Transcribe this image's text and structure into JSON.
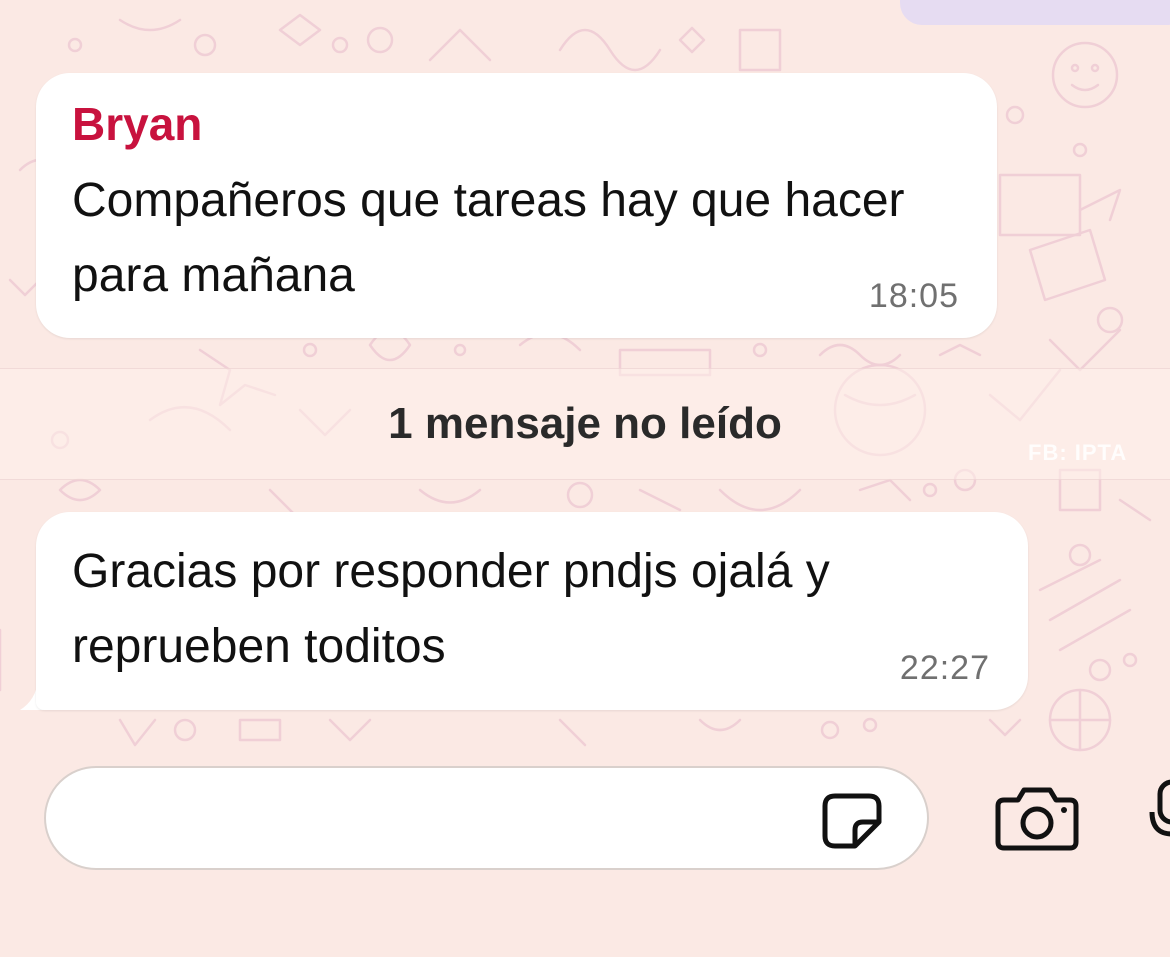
{
  "messages": [
    {
      "sender": "Bryan",
      "text": "Compañeros que tareas hay que hacer para mañana",
      "time": "18:05"
    },
    {
      "text": "Gracias por responder pndjs ojalá y reprueben toditos",
      "time": "22:27"
    }
  ],
  "unread_banner": "1 mensaje no leído",
  "watermark": "FB: IPTA",
  "composer": {
    "placeholder": "",
    "icons": [
      "sticker-icon",
      "camera-icon",
      "microphone-icon"
    ]
  },
  "colors": {
    "background": "#fbe9e4",
    "bubble": "#ffffff",
    "sender_name": "#c8123e",
    "time": "#707070"
  }
}
